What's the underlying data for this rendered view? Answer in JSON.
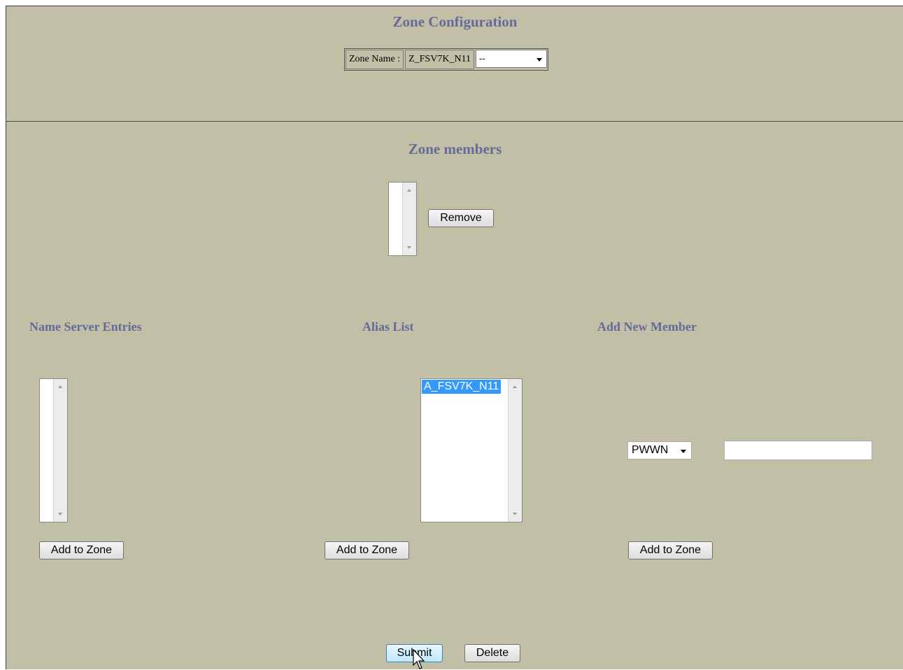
{
  "zone_configuration": {
    "title": "Zone Configuration",
    "zone_name_label": "Zone Name :",
    "zone_name_value": "Z_FSV7K_N11",
    "zone_select_value": "--"
  },
  "zone_members": {
    "title": "Zone members",
    "items": [],
    "remove_label": "Remove"
  },
  "name_server_entries": {
    "title": "Name Server Entries",
    "items": [],
    "add_label": "Add to Zone"
  },
  "alias_list": {
    "title": "Alias List",
    "items": [
      "A_FSV7K_N11"
    ],
    "selected": "A_FSV7K_N11",
    "add_label": "Add to Zone"
  },
  "add_new_member": {
    "title": "Add New Member",
    "type_select_value": "PWWN",
    "input_value": "",
    "add_label": "Add to Zone"
  },
  "footer": {
    "submit_label": "Submit",
    "delete_label": "Delete"
  },
  "colors": {
    "background": "#c1c0a6",
    "heading": "#66699a",
    "selection": "#3399ff"
  }
}
